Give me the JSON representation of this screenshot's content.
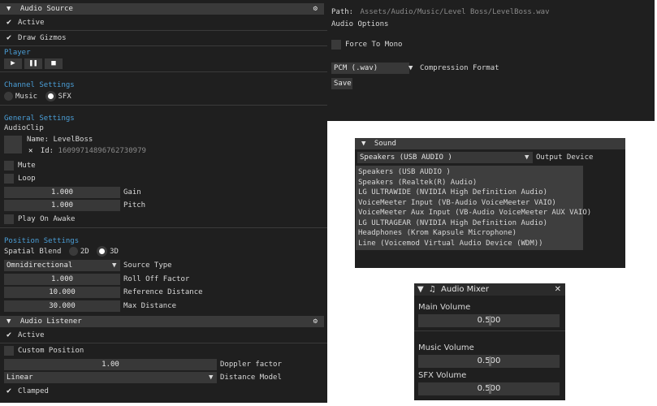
{
  "audio_source": {
    "title": "Audio Source",
    "active_label": "Active",
    "draw_gizmos_label": "Draw Gizmos",
    "player_section": "Player",
    "player_buttons": [
      "▶",
      "❚❚",
      "■"
    ],
    "channel_section": "Channel Settings",
    "channel_music": "Music",
    "channel_sfx": "SFX",
    "general_section": "General Settings",
    "audioclip_label": "AudioClip",
    "name_label": "Name: LevelBoss",
    "remove_symbol": "✕",
    "id_prefix": "Id:",
    "id_value": "16099714896762730979",
    "mute_label": "Mute",
    "loop_label": "Loop",
    "gain_value": "1.000",
    "gain_label": "Gain",
    "pitch_value": "1.000",
    "pitch_label": "Pitch",
    "play_on_awake_label": "Play On Awake",
    "position_section": "Position Settings",
    "spatial_blend_label": "Spatial Blend",
    "blend_2d": "2D",
    "blend_3d": "3D",
    "source_type_value": "Omnidirectional",
    "source_type_label": "Source Type",
    "rolloff_value": "1.000",
    "rolloff_label": "Roll Off Factor",
    "ref_distance_value": "10.000",
    "ref_distance_label": "Reference Distance",
    "max_distance_value": "30.000",
    "max_distance_label": "Max Distance"
  },
  "audio_listener": {
    "title": "Audio Listener",
    "active_label": "Active",
    "custom_position_label": "Custom Position",
    "doppler_value": "1.00",
    "doppler_label": "Doppler factor",
    "distance_model_value": "Linear",
    "distance_model_label": "Distance Model",
    "clamped_label": "Clamped"
  },
  "asset": {
    "path_label": "Path:",
    "path_value": "Assets/Audio/Music/Level Boss/LevelBoss.wav",
    "options_section": "Audio Options",
    "force_mono_label": "Force To Mono",
    "format_value": "PCM (.wav)",
    "format_label": "Compression Format",
    "save_label": "Save"
  },
  "sound": {
    "title": "Sound",
    "selected_device": "Speakers (USB  AUDIO  )",
    "device_label": "Output Device",
    "devices": [
      "Speakers (USB  AUDIO  )",
      "Speakers (Realtek(R) Audio)",
      "LG ULTRAWIDE (NVIDIA High Definition Audio)",
      "VoiceMeeter Input (VB-Audio VoiceMeeter VAIO)",
      "VoiceMeeter Aux Input (VB-Audio VoiceMeeter AUX VAIO)",
      "LG ULTRAGEAR (NVIDIA High Definition Audio)",
      "Headphones (Krom Kapsule Microphone)",
      "Line (Voicemod Virtual Audio Device (WDM))"
    ]
  },
  "mixer": {
    "title": "Audio Mixer",
    "close_symbol": "✕",
    "main_label": "Main Volume",
    "main_value": "0.500",
    "main_level": 0.5,
    "music_label": "Music Volume",
    "music_value": "0.500",
    "music_level": 0.5,
    "sfx_label": "SFX Volume",
    "sfx_value": "0.500",
    "sfx_level": 0.5
  },
  "colors": {
    "accent": "#4b9fd8",
    "panel": "#1f1f1f",
    "header": "#3a3a3a",
    "widget": "#383838"
  }
}
